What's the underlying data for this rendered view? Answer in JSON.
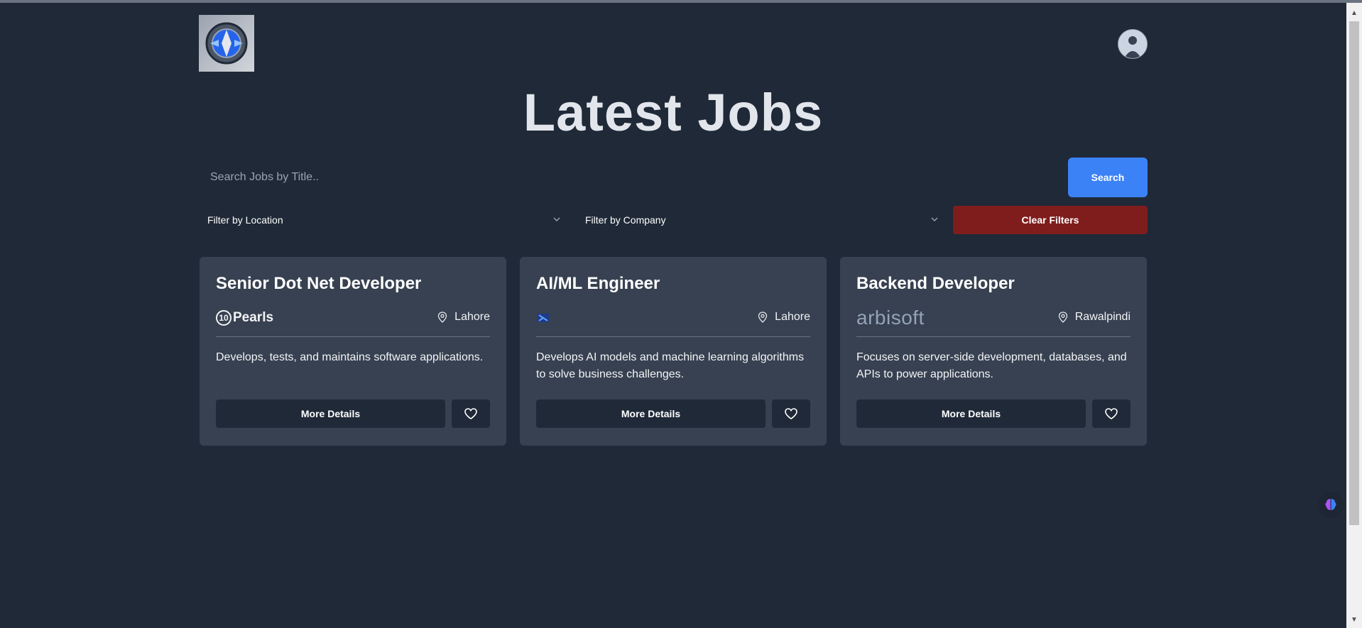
{
  "header": {
    "logo_icon": "shield-logo-icon",
    "avatar_icon": "user-avatar"
  },
  "page": {
    "title": "Latest Jobs"
  },
  "search": {
    "placeholder": "Search Jobs by Title..",
    "value": "",
    "button_label": "Search"
  },
  "filters": {
    "location_label": "Filter by Location",
    "company_label": "Filter by Company",
    "clear_label": "Clear Filters"
  },
  "jobs": [
    {
      "title": "Senior Dot Net Developer",
      "company_logo_text": "Pearls",
      "company_logo_mark": "10",
      "location": "Lahore",
      "description": "Develops, tests, and maintains software applications.",
      "details_label": "More Details"
    },
    {
      "title": "AI/ML Engineer",
      "company_logo_text": "",
      "location": "Lahore",
      "description": "Develops AI models and machine learning algorithms to solve business challenges.",
      "details_label": "More Details"
    },
    {
      "title": "Backend Developer",
      "company_logo_text": "arbisoft",
      "location": "Rawalpindi",
      "description": "Focuses on server-side development, databases, and APIs to power applications.",
      "details_label": "More Details"
    }
  ],
  "colors": {
    "background": "#1f2937",
    "card": "#374151",
    "primary": "#3b82f6",
    "danger": "#7f1d1d"
  }
}
